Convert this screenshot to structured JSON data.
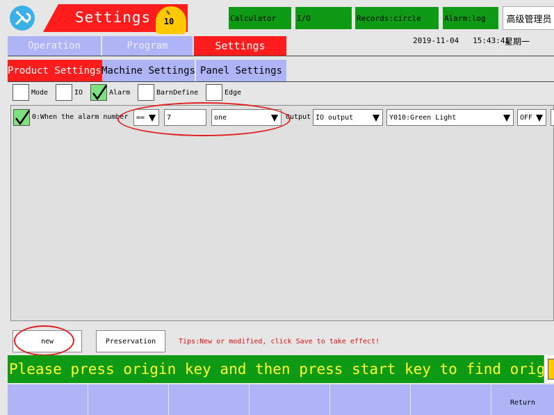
{
  "header": {
    "title": "Settings",
    "gauge_value": "10",
    "gauge_unit": "%",
    "buttons": {
      "calculator": "Calculator",
      "io": "I/O",
      "records": "Records:circle",
      "alarm_log": "Alarm:log"
    },
    "user": "高级管理员"
  },
  "tabs": {
    "operation": "Operation",
    "program": "Program",
    "settings": "Settings"
  },
  "datetime": "2019-11-04   15:43:41",
  "weekday": "星期一",
  "subtabs": {
    "product": "Product Settings",
    "machine": "Machine Settings",
    "panel": "Panel Settings"
  },
  "filters": {
    "mode": "Mode",
    "io": "IO",
    "alarm": "Alarm",
    "barn": "BarnDefine",
    "edge": "Edge"
  },
  "row": {
    "label": "0:When the alarm number",
    "operator": "==",
    "value": "7",
    "unit": "one",
    "output_label": "Output",
    "output_type": "IO output",
    "port": "Y010:Green Light",
    "state": "OFF"
  },
  "actions": {
    "new": "new",
    "save": "Preservation",
    "tips": "Tips:New or modified, click Save to take effect!"
  },
  "ticker": "Please press origin key and then press start key to find origin",
  "bottom_nav": {
    "return": "Return"
  },
  "colors": {
    "accent_red": "#ff1c1c",
    "tab_lavender": "#aeb4f5",
    "button_green": "#0e9a14",
    "ticker_text": "#ffff33",
    "gauge_yellow": "#ffc800"
  },
  "icons": {
    "tool": "wrench-screwdriver-icon",
    "checkmark": "check-icon",
    "dropdown": "triangle-down-icon"
  }
}
